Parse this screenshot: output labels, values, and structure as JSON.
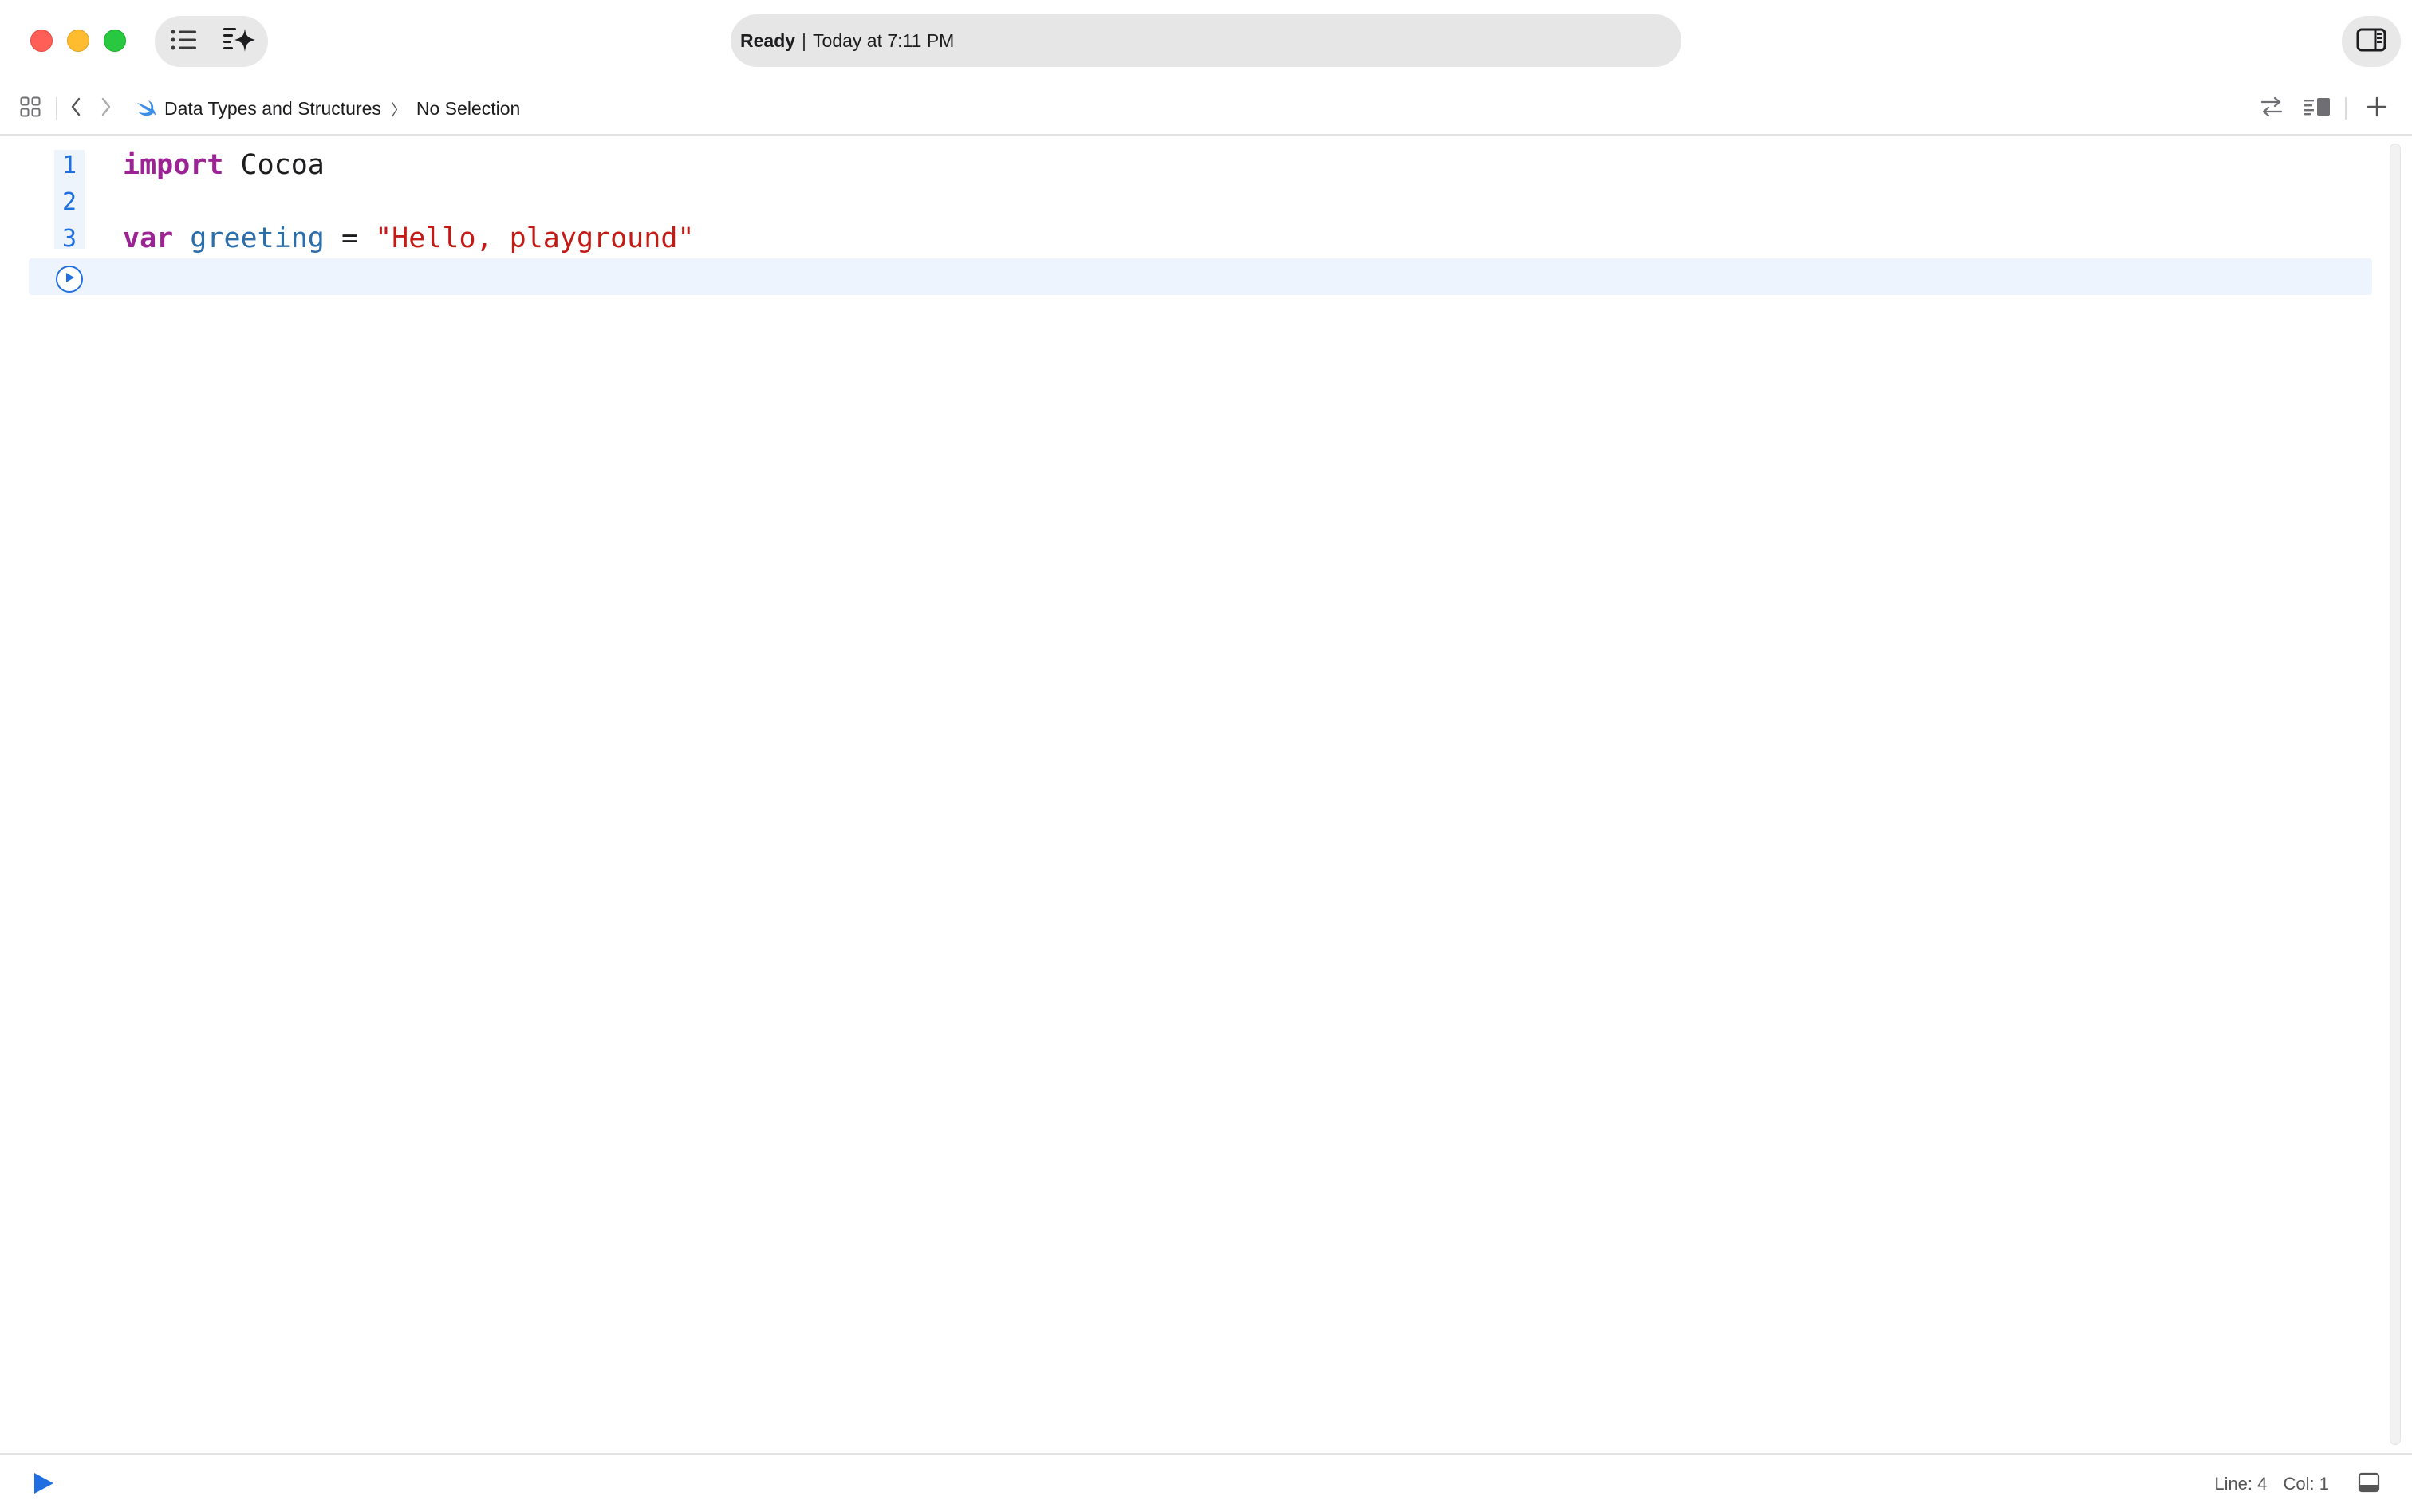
{
  "window": {
    "status": {
      "state": "Ready",
      "separator": "|",
      "time": "Today at 7:11 PM"
    }
  },
  "toolbar": {
    "navigator_toggle_icon": "list-icon",
    "assistant_icon": "sparkle-icon",
    "inspector_toggle_icon": "sidebar-right-icon"
  },
  "jumpbar": {
    "related_items_icon": "grid-icon",
    "back_icon": "chevron-left-icon",
    "forward_icon": "chevron-right-icon",
    "breadcrumbs": [
      {
        "icon": "swift-icon",
        "label": "Data Types and Structures"
      },
      {
        "label": "No Selection"
      }
    ],
    "chevron": "〉",
    "right_icons": [
      "swap-icon",
      "editor-options-icon",
      "add-icon"
    ]
  },
  "editor": {
    "lines": [
      {
        "number": "1",
        "tokens": [
          {
            "type": "kw",
            "text": "import"
          },
          {
            "type": "plain",
            "text": " Cocoa"
          }
        ]
      },
      {
        "number": "2",
        "tokens": []
      },
      {
        "number": "3",
        "tokens": [
          {
            "type": "kw",
            "text": "var"
          },
          {
            "type": "plain",
            "text": " "
          },
          {
            "type": "ident2",
            "text": "greeting"
          },
          {
            "type": "plain",
            "text": " = "
          },
          {
            "type": "str",
            "text": "\"Hello, playground\""
          }
        ]
      }
    ],
    "line_numbers": [
      "1",
      "2",
      "3"
    ],
    "line1": {
      "kw": "import",
      "rest": " Cocoa"
    },
    "line3": {
      "kw": "var",
      "space": " ",
      "ident": "greeting",
      "op": " = ",
      "str": "\"Hello, playground\""
    }
  },
  "bottombar": {
    "line": "Line: 4",
    "col": "Col: 1"
  },
  "colors": {
    "accent": "#1f6fe0",
    "keyword": "#9b2393",
    "string": "#c41a16",
    "identifier": "#2b6ea9",
    "current_line": "#edf4fd"
  }
}
